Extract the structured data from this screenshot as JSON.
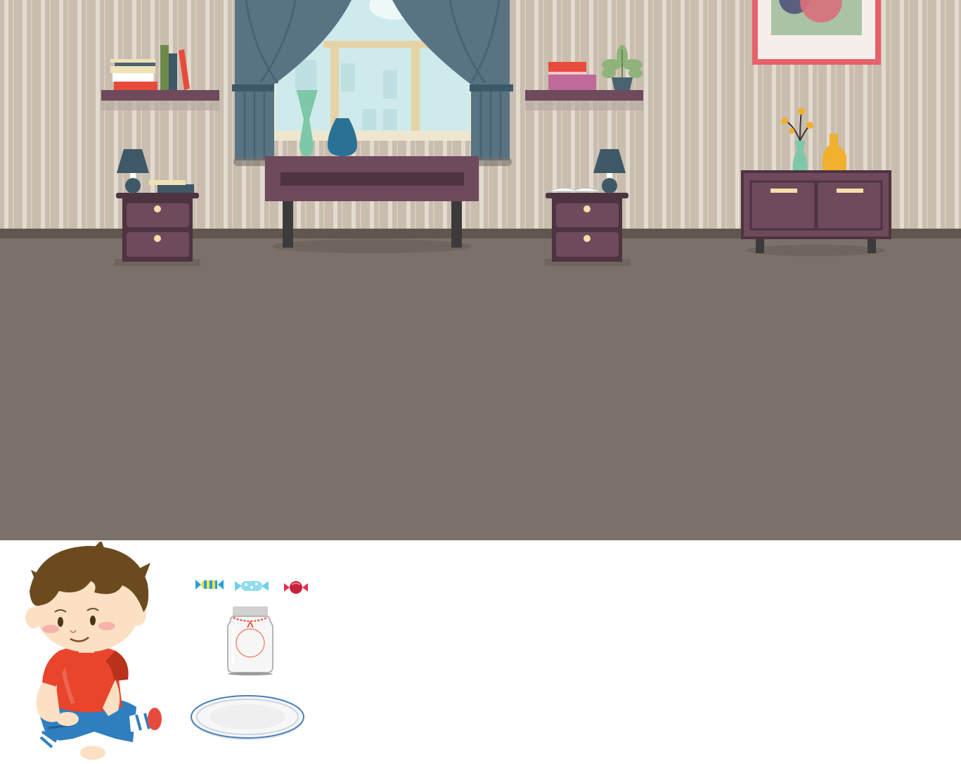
{
  "scene": {
    "name": "Living room",
    "colors": {
      "wall": "#c9beb0",
      "wall_stripe": "#e6ddd0",
      "floor": "#7a7268",
      "baseboard": "#5f574d",
      "furniture": "#6e4a5c",
      "furniture_dark": "#4e3341",
      "curtain": "#587484",
      "window_glass": "#cde9ea",
      "frame_red": "#e8606a"
    },
    "objects": [
      {
        "id": "bookshelf-left",
        "icon": "shelf-with-books"
      },
      {
        "id": "window",
        "icon": "window-with-curtains"
      },
      {
        "id": "bookshelf-right",
        "icon": "shelf-with-boxes-and-plant"
      },
      {
        "id": "wall-picture",
        "icon": "framed-picture"
      },
      {
        "id": "nightstand-left",
        "icon": "nightstand-with-lamp"
      },
      {
        "id": "desk",
        "icon": "desk-with-vases"
      },
      {
        "id": "nightstand-right",
        "icon": "nightstand-with-lamp-and-book"
      },
      {
        "id": "sideboard",
        "icon": "sideboard-with-flowers"
      }
    ]
  },
  "tray": {
    "character": {
      "icon": "boy-sitting"
    },
    "items": [
      {
        "id": "candy-striped-yellow",
        "icon": "candy-icon",
        "color": "#2a9fd6"
      },
      {
        "id": "candy-dotted-blue",
        "icon": "candy-icon",
        "color": "#6fd0e8"
      },
      {
        "id": "candy-red",
        "icon": "candy-icon",
        "color": "#e0334c"
      },
      {
        "id": "jar",
        "icon": "glass-jar-icon"
      },
      {
        "id": "plate",
        "icon": "plate-icon"
      }
    ]
  }
}
